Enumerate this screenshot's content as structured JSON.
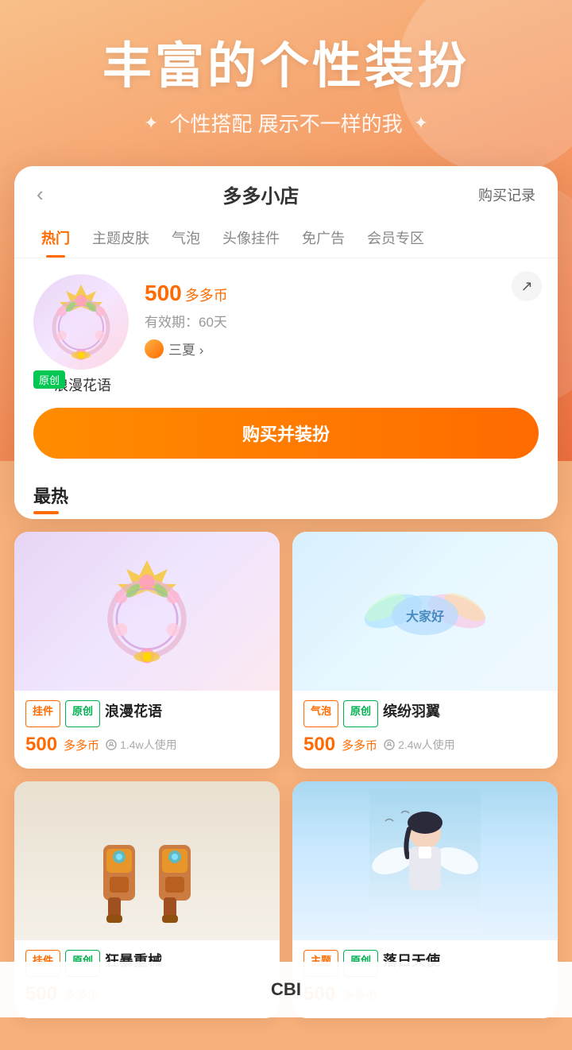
{
  "hero": {
    "title": "丰富的个性装扮",
    "subtitle": "个性搭配 展示不一样的我",
    "sparkle_left": "✦",
    "sparkle_right": "✦"
  },
  "shop": {
    "back_label": "‹",
    "title": "多多小店",
    "history_label": "购买记录",
    "tabs": [
      {
        "label": "热门",
        "active": true
      },
      {
        "label": "主题皮肤",
        "active": false
      },
      {
        "label": "气泡",
        "active": false
      },
      {
        "label": "头像挂件",
        "active": false
      },
      {
        "label": "免广告",
        "active": false
      },
      {
        "label": "会员专区",
        "active": false
      }
    ],
    "featured": {
      "original_badge": "原创",
      "name": "浪漫花语",
      "price": "500",
      "price_unit": "多多币",
      "validity_label": "有效期：60天",
      "author": "三夏 ›",
      "share_icon": "↗",
      "buy_button": "购买并装扮"
    },
    "section_label": "最热",
    "products": [
      {
        "type": "挂件",
        "original": "原创",
        "name": "浪漫花语",
        "price": "500",
        "price_unit": "多多币",
        "users": "1.4w人使用",
        "image_type": "frame"
      },
      {
        "type": "气泡",
        "original": "原创",
        "name": "缤纷羽翼",
        "price": "500",
        "price_unit": "多多币",
        "users": "2.4w人使用",
        "image_type": "bubble"
      },
      {
        "type": "挂件",
        "original": "原创",
        "name": "狂暴重械",
        "price": "500",
        "price_unit": "",
        "users": "",
        "image_type": "robot"
      },
      {
        "type": "主题",
        "original": "原创",
        "name": "落日天使",
        "price": "500",
        "price_unit": "",
        "users": "",
        "image_type": "anime"
      }
    ]
  },
  "bottom": {
    "cbi_label": "CBI"
  }
}
